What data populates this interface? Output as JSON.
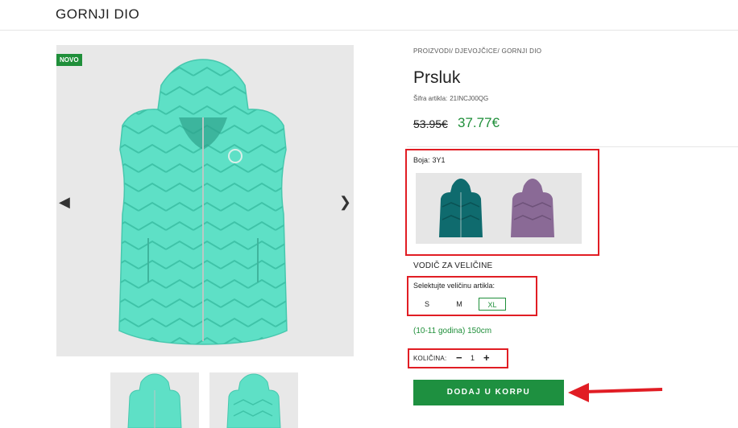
{
  "header": {
    "title": "GORNJI DIO"
  },
  "gallery": {
    "badge": "NOVO",
    "prev_icon": "chevron-left-icon",
    "next_icon": "chevron-right-icon"
  },
  "product": {
    "breadcrumb": "PROIZVODI/ DJEVOJČICE/ GORNJI DIO",
    "name": "Prsluk",
    "sku_label": "Šifra artikla:",
    "sku_value": "21INCJ00QG",
    "price_old": "53.95€",
    "price_new": "37.77€"
  },
  "color": {
    "label": "Boja:",
    "value": "3Y1",
    "swatches": [
      {
        "color": "#0f6b6e"
      },
      {
        "color": "#8a6a96"
      }
    ]
  },
  "size": {
    "guide": "VODIČ ZA VELIČINE",
    "label": "Selektujte veličinu artikla:",
    "options": [
      "S",
      "M",
      "XL"
    ],
    "selected": "XL",
    "info": "(10-11 godina) 150cm"
  },
  "quantity": {
    "label": "KOLIČINA:",
    "minus": "−",
    "value": "1",
    "plus": "+"
  },
  "cart": {
    "add_label": "DODAJ U KORPU"
  },
  "colors": {
    "accent": "#1f8f3a",
    "highlight": "#e11d24",
    "vest": "#5ee0c6"
  }
}
